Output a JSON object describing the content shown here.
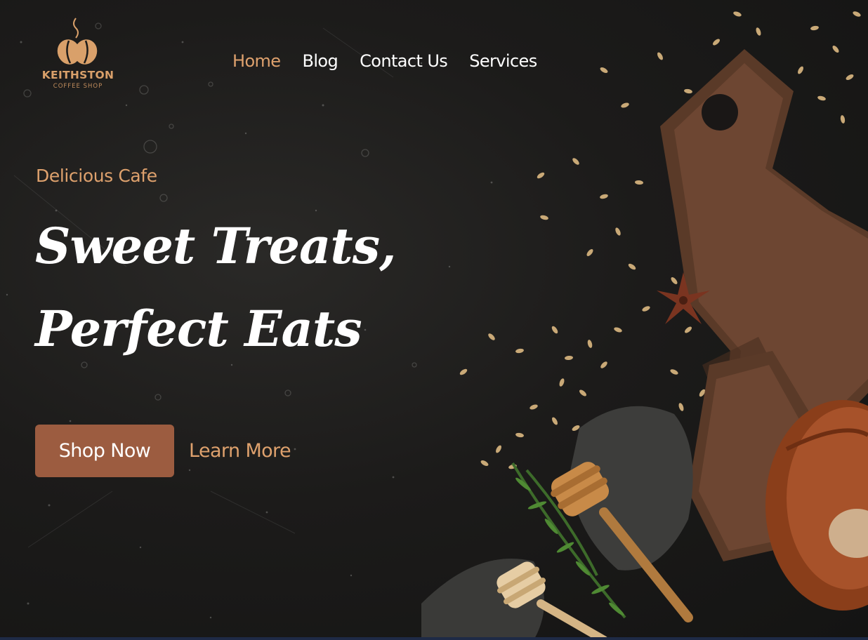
{
  "brand": {
    "name": "KEITHSTON",
    "tagline": "COFFEE SHOP",
    "icon": "coffee-bean-logo"
  },
  "nav": {
    "items": [
      {
        "label": "Home",
        "active": true
      },
      {
        "label": "Blog",
        "active": false
      },
      {
        "label": "Contact Us",
        "active": false
      },
      {
        "label": "Services",
        "active": false
      }
    ]
  },
  "hero": {
    "eyebrow": "Delicious Cafe",
    "headline_line1": "Sweet Treats,",
    "headline_line2": "Perfect Eats",
    "primary_button": "Shop Now",
    "secondary_button": "Learn More",
    "background_image": "food-flatlay-image"
  },
  "colors": {
    "accent": "#dea16d",
    "button": "#9c5c40",
    "background": "#1c1b1a",
    "text": "#ffffff"
  }
}
